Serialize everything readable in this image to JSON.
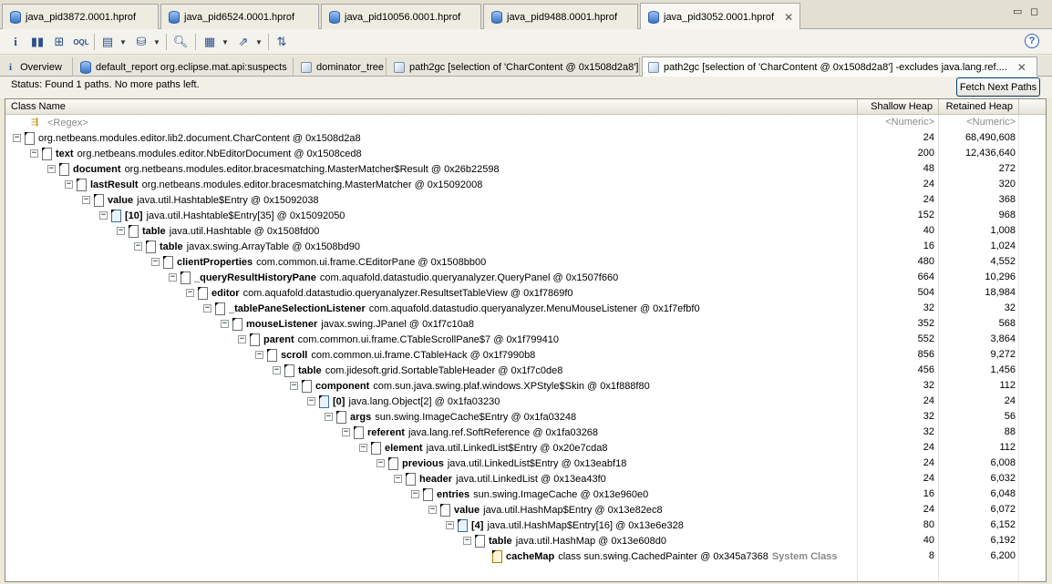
{
  "editor_tabs": [
    {
      "label": "java_pid3872.0001.hprof",
      "active": false
    },
    {
      "label": "java_pid6524.0001.hprof",
      "active": false
    },
    {
      "label": "java_pid10056.0001.hprof",
      "active": false
    },
    {
      "label": "java_pid9488.0001.hprof",
      "active": false
    },
    {
      "label": "java_pid3052.0001.hprof",
      "active": true
    }
  ],
  "toolbar": {
    "icons": [
      "info-icon",
      "histogram-icon",
      "dominator-tree-icon",
      "oql-icon",
      "run-report-icon",
      "query-browser-icon",
      "search-icon",
      "calculate-retained-icon",
      "export-icon",
      "group-by-icon",
      "help-icon"
    ]
  },
  "sub_tabs": [
    {
      "label": "Overview",
      "active": false
    },
    {
      "label": "default_report  org.eclipse.mat.api:suspects",
      "active": false
    },
    {
      "label": "dominator_tree",
      "active": false
    },
    {
      "label": "path2gc [selection of 'CharContent @ 0x1508d2a8']",
      "active": false
    },
    {
      "label": "path2gc [selection of 'CharContent @ 0x1508d2a8'] -excludes java.lang.ref....",
      "active": true
    }
  ],
  "status": {
    "text": "Status:   Found 1 paths. No more paths left.",
    "fetch_button": "Fetch Next Paths"
  },
  "columns": {
    "class_name": "Class Name",
    "shallow_heap": "Shallow Heap",
    "retained_heap": "Retained Heap"
  },
  "filter_row": {
    "regex": "<Regex>",
    "shallow": "<Numeric>",
    "retained": "<Numeric>"
  },
  "rows": [
    {
      "depth": 0,
      "field": "",
      "type": "org.netbeans.modules.editor.lib2.document.CharContent @ 0x1508d2a8",
      "icon": "obj",
      "shallow": "24",
      "retained": "68,490,608"
    },
    {
      "depth": 1,
      "field": "text",
      "type": "org.netbeans.modules.editor.NbEditorDocument @ 0x1508ced8",
      "icon": "obj",
      "shallow": "200",
      "retained": "12,436,640"
    },
    {
      "depth": 2,
      "field": "document",
      "type": "org.netbeans.modules.editor.bracesmatching.MasterMatcher$Result @ 0x26b22598",
      "icon": "obj",
      "shallow": "48",
      "retained": "272"
    },
    {
      "depth": 3,
      "field": "lastResult",
      "type": "org.netbeans.modules.editor.bracesmatching.MasterMatcher @ 0x15092008",
      "icon": "obj",
      "shallow": "24",
      "retained": "320"
    },
    {
      "depth": 4,
      "field": "value",
      "type": "java.util.Hashtable$Entry @ 0x15092038",
      "icon": "obj",
      "shallow": "24",
      "retained": "368"
    },
    {
      "depth": 5,
      "field": "[10]",
      "type": "java.util.Hashtable$Entry[35] @ 0x15092050",
      "icon": "arr",
      "shallow": "152",
      "retained": "968"
    },
    {
      "depth": 6,
      "field": "table",
      "type": "java.util.Hashtable @ 0x1508fd00",
      "icon": "obj",
      "shallow": "40",
      "retained": "1,008"
    },
    {
      "depth": 7,
      "field": "table",
      "type": "javax.swing.ArrayTable @ 0x1508bd90",
      "icon": "obj",
      "shallow": "16",
      "retained": "1,024"
    },
    {
      "depth": 8,
      "field": "clientProperties",
      "type": "com.common.ui.frame.CEditorPane @ 0x1508bb00",
      "icon": "obj",
      "shallow": "480",
      "retained": "4,552"
    },
    {
      "depth": 9,
      "field": "_queryResultHistoryPane",
      "type": "com.aquafold.datastudio.queryanalyzer.QueryPanel @ 0x1507f660",
      "icon": "obj",
      "shallow": "664",
      "retained": "10,296"
    },
    {
      "depth": 10,
      "field": "editor",
      "type": "com.aquafold.datastudio.queryanalyzer.ResultsetTableView @ 0x1f7869f0",
      "icon": "obj",
      "shallow": "504",
      "retained": "18,984"
    },
    {
      "depth": 11,
      "field": "_tablePaneSelectionListener",
      "type": "com.aquafold.datastudio.queryanalyzer.MenuMouseListener @ 0x1f7efbf0",
      "icon": "obj",
      "shallow": "32",
      "retained": "32"
    },
    {
      "depth": 12,
      "field": "mouseListener",
      "type": "javax.swing.JPanel @ 0x1f7c10a8",
      "icon": "obj",
      "shallow": "352",
      "retained": "568"
    },
    {
      "depth": 13,
      "field": "parent",
      "type": "com.common.ui.frame.CTableScrollPane$7 @ 0x1f799410",
      "icon": "obj",
      "shallow": "552",
      "retained": "3,864"
    },
    {
      "depth": 14,
      "field": "scroll",
      "type": "com.common.ui.frame.CTableHack @ 0x1f7990b8",
      "icon": "obj",
      "shallow": "856",
      "retained": "9,272"
    },
    {
      "depth": 15,
      "field": "table",
      "type": "com.jidesoft.grid.SortableTableHeader @ 0x1f7c0de8",
      "icon": "obj",
      "shallow": "456",
      "retained": "1,456"
    },
    {
      "depth": 16,
      "field": "component",
      "type": "com.sun.java.swing.plaf.windows.XPStyle$Skin @ 0x1f888f80",
      "icon": "obj",
      "shallow": "32",
      "retained": "112"
    },
    {
      "depth": 17,
      "field": "[0]",
      "type": "java.lang.Object[2] @ 0x1fa03230",
      "icon": "arr",
      "shallow": "24",
      "retained": "24"
    },
    {
      "depth": 18,
      "field": "args",
      "type": "sun.swing.ImageCache$Entry @ 0x1fa03248",
      "icon": "obj",
      "shallow": "32",
      "retained": "56"
    },
    {
      "depth": 19,
      "field": "referent",
      "type": "java.lang.ref.SoftReference @ 0x1fa03268",
      "icon": "obj",
      "shallow": "32",
      "retained": "88"
    },
    {
      "depth": 20,
      "field": "element",
      "type": "java.util.LinkedList$Entry @ 0x20e7cda8",
      "icon": "obj",
      "shallow": "24",
      "retained": "112"
    },
    {
      "depth": 21,
      "field": "previous",
      "type": "java.util.LinkedList$Entry @ 0x13eabf18",
      "icon": "obj",
      "shallow": "24",
      "retained": "6,008"
    },
    {
      "depth": 22,
      "field": "header",
      "type": "java.util.LinkedList @ 0x13ea43f0",
      "icon": "obj",
      "shallow": "24",
      "retained": "6,032"
    },
    {
      "depth": 23,
      "field": "entries",
      "type": "sun.swing.ImageCache @ 0x13e960e0",
      "icon": "obj",
      "shallow": "16",
      "retained": "6,048"
    },
    {
      "depth": 24,
      "field": "value",
      "type": "java.util.HashMap$Entry @ 0x13e82ec8",
      "icon": "obj",
      "shallow": "24",
      "retained": "6,072"
    },
    {
      "depth": 25,
      "field": "[4]",
      "type": "java.util.HashMap$Entry[16] @ 0x13e6e328",
      "icon": "arr",
      "shallow": "80",
      "retained": "6,152"
    },
    {
      "depth": 26,
      "field": "table",
      "type": "java.util.HashMap @ 0x13e608d0",
      "icon": "obj",
      "shallow": "40",
      "retained": "6,192"
    },
    {
      "depth": 27,
      "field": "cacheMap",
      "type": "class sun.swing.CachedPainter @ 0x345a7368",
      "icon": "cls",
      "shallow": "8",
      "retained": "6,200",
      "suffix": "System Class",
      "leaf": true
    }
  ]
}
